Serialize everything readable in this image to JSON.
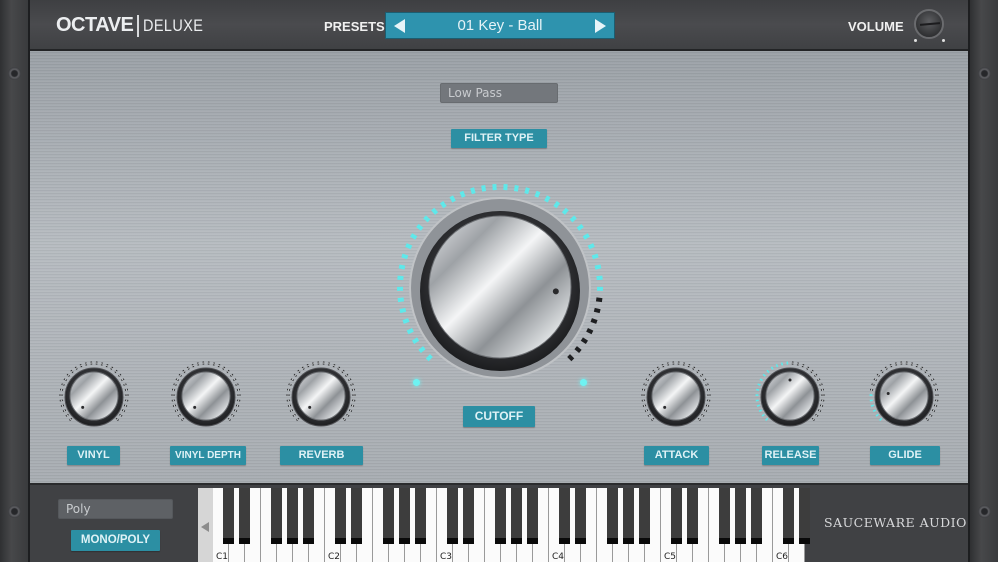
{
  "app": {
    "title_main": "OCTAVE",
    "title_sub": "DELUXE",
    "brand": "SAUCEWARE AUDIO"
  },
  "header": {
    "presets_label": "PRESETS",
    "preset_name": "01 Key - Ball",
    "prev_icon": "triangle-left",
    "next_icon": "triangle-right",
    "volume_label": "VOLUME"
  },
  "filter": {
    "type_value": "Low Pass",
    "type_label": "FILTER TYPE"
  },
  "cutoff": {
    "label": "CUTOFF",
    "value_fraction": 0.85
  },
  "knobs": [
    {
      "id": "vinyl",
      "label": "VINYL",
      "value_fraction": 0.0
    },
    {
      "id": "vinyl-depth",
      "label": "VINYL DEPTH",
      "value_fraction": 0.0
    },
    {
      "id": "reverb",
      "label": "REVERB",
      "value_fraction": 0.0
    },
    {
      "id": "attack",
      "label": "ATTACK",
      "value_fraction": 0.0
    },
    {
      "id": "release",
      "label": "RELEASE",
      "value_fraction": 0.5
    },
    {
      "id": "glide",
      "label": "GLIDE",
      "value_fraction": 0.2
    }
  ],
  "voice": {
    "mode_value": "Poly",
    "mode_label": "MONO/POLY"
  },
  "keyboard": {
    "octave_labels": [
      "C1",
      "C2",
      "C3",
      "C4",
      "C5",
      "C6"
    ],
    "scroll_icon": "triangle-left"
  },
  "colors": {
    "accent": "#2c8fa3",
    "led": "#6ef2f2",
    "preset_bg": "#2e93ae"
  }
}
